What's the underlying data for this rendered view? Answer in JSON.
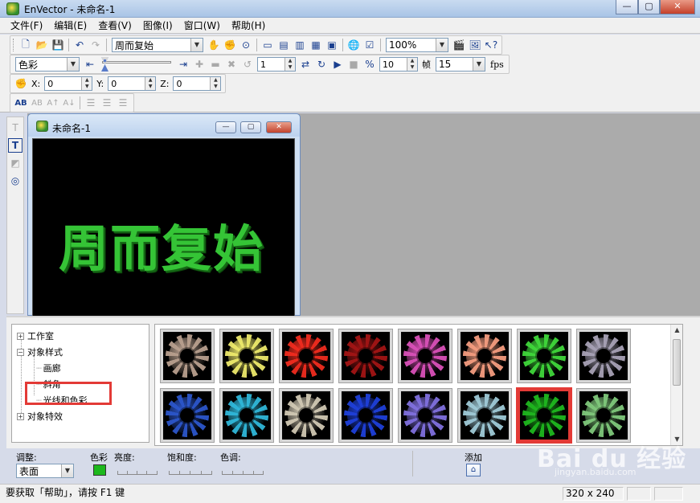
{
  "window": {
    "title": "EnVector - 未命名-1",
    "min": "—",
    "max": "▢",
    "close": "✕"
  },
  "menu": [
    "文件(F)",
    "编辑(E)",
    "查看(V)",
    "图像(I)",
    "窗口(W)",
    "帮助(H)"
  ],
  "toolbar": {
    "text_combo": "周而复始",
    "zoom_combo": "100%",
    "mode_combo": "色彩",
    "frame_value": "1",
    "step_value": "10",
    "frame_label": "帧",
    "fps_combo": "15",
    "fps_label": "fps",
    "x_label": "X:",
    "x_value": "0",
    "y_label": "Y:",
    "y_value": "0",
    "z_label": "Z:",
    "z_value": "0"
  },
  "document": {
    "title": "未命名-1",
    "canvas_text": "周而复始",
    "text_color": "#35c436"
  },
  "tree": {
    "items": [
      {
        "label": "工作室",
        "expander": "+"
      },
      {
        "label": "对象样式",
        "expander": "−"
      },
      {
        "label": "画廊"
      },
      {
        "label": "斜角"
      },
      {
        "label": "光线和色彩"
      },
      {
        "label": "对象特效",
        "expander": "+"
      }
    ],
    "highlight_color": "#e33a36"
  },
  "gallery": {
    "rows": [
      [
        "#b79e8d",
        "#ece86a",
        "#ef2b1e",
        "#a11414",
        "#d84fb7",
        "#f39b7e",
        "#3fd63a",
        "#a6a0b4"
      ],
      [
        "#2b55c9",
        "#2fb6d8",
        "#cfc7b2",
        "#1e3fd8",
        "#7f6fdd",
        "#9ec9d6",
        "#1eb61e",
        "#7ec77a"
      ]
    ],
    "selected": {
      "row": 1,
      "col": 6
    }
  },
  "adjust": {
    "adjust_label": "调整:",
    "surface_combo": "表面",
    "color_label": "色彩",
    "brightness_label": "亮度:",
    "saturation_label": "饱和度:",
    "hue_label": "色调:",
    "add_label": "添加",
    "swatch_color": "#1db81d"
  },
  "status": {
    "help_text": "要获取「帮助」，请按 F1 键",
    "size_text": "320 x 240"
  },
  "watermark": {
    "main": "Bai du 经验",
    "sub": "jingyan.baidu.com"
  }
}
